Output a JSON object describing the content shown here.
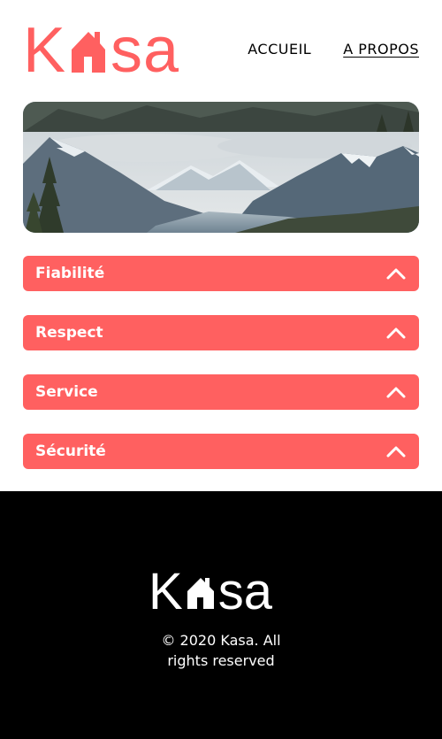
{
  "brand": {
    "logo_text_left": "K",
    "logo_text_right": "sa",
    "logo_alt": "Kasa",
    "color": "#FF6060"
  },
  "nav": {
    "items": [
      {
        "label": "ACCUEIL",
        "active": false
      },
      {
        "label": "A PROPOS",
        "active": true
      }
    ]
  },
  "banner": {
    "icon": "mountain-landscape-image"
  },
  "collapses": [
    {
      "title": "Fiabilité",
      "icon": "chevron-up-icon"
    },
    {
      "title": "Respect",
      "icon": "chevron-up-icon"
    },
    {
      "title": "Service",
      "icon": "chevron-up-icon"
    },
    {
      "title": "Sécurité",
      "icon": "chevron-up-icon"
    }
  ],
  "footer": {
    "logo_text_left": "K",
    "logo_text_right": "sa",
    "copyright_line1": "© 2020 Kasa. All",
    "copyright_line2": "rights reserved",
    "background": "#000000"
  }
}
